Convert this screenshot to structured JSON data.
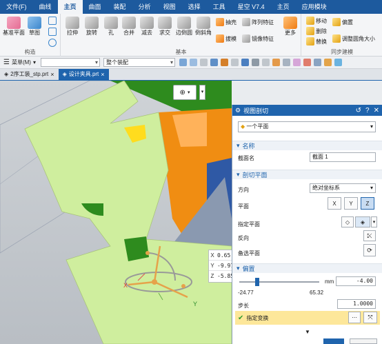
{
  "menu": [
    "文件(F)",
    "曲线",
    "主页",
    "曲面",
    "装配",
    "分析",
    "视图",
    "选择",
    "工具",
    "星空 V7.4",
    "主页",
    "应用模块"
  ],
  "menu_active_index": 2,
  "ribbon": {
    "construct": {
      "label": "构造",
      "datum_plane": "基准平面",
      "sketch": "草图"
    },
    "basic": {
      "label": "基本",
      "extrude": "拉伸",
      "revolve": "旋转",
      "hole": "孔",
      "unite": "合并",
      "subtract": "减去",
      "intersect": "求交",
      "edge_blend": "边倒圆",
      "chamfer": "倒斜角",
      "shell": "抽壳",
      "draft": "拔模",
      "pattern_feature": "阵列特征",
      "mirror_feature": "镜像特征",
      "more": "更多"
    },
    "sync": {
      "label": "同步建模",
      "move": "移动",
      "delete": "删除",
      "replace": "替换",
      "offset": "偏置",
      "resize_blend": "调整圆角大小"
    }
  },
  "toolbar": {
    "menu_label": "菜单(M)",
    "filter_label": "整个装配"
  },
  "tabs": [
    {
      "label": "2序工装_stp.prt",
      "active": false
    },
    {
      "label": "设计夹具.prt",
      "active": true
    }
  ],
  "coords": {
    "x_label": "X",
    "x_value": "0.65",
    "y_label": "Y",
    "y_value": "-9.97",
    "z_label": "Z",
    "z_value": "-5.85"
  },
  "axes": {
    "x": "X",
    "y": "Y"
  },
  "dialog": {
    "title": "视图剖切",
    "type_value": "一个平面",
    "section_name": {
      "header": "名称",
      "field_label": "截面名",
      "field_value": "截面 1"
    },
    "section_plane": {
      "header": "剖切平面",
      "direction_label": "方向",
      "direction_value": "绝对坐标系",
      "plane_label": "平面",
      "plane_x": "X",
      "plane_y": "Y",
      "plane_z": "Z",
      "specify_plane_label": "指定平面",
      "reverse_label": "反向",
      "alternate_plane_label": "备选平面"
    },
    "offset": {
      "header": "偏置",
      "unit": "mm",
      "value": "-4.00",
      "min": "-24.77",
      "max": "65.32",
      "slider_level": 0.22,
      "step_label": "步长",
      "step_value": "1.0000",
      "specify_transform_label": "指定变换"
    }
  },
  "colors": {
    "menubar": "#1d5a9e",
    "accent": "#1f64ad",
    "part_green": "#cfee9e",
    "part_orange": "#f08d12",
    "highlight": "#fde79a"
  }
}
